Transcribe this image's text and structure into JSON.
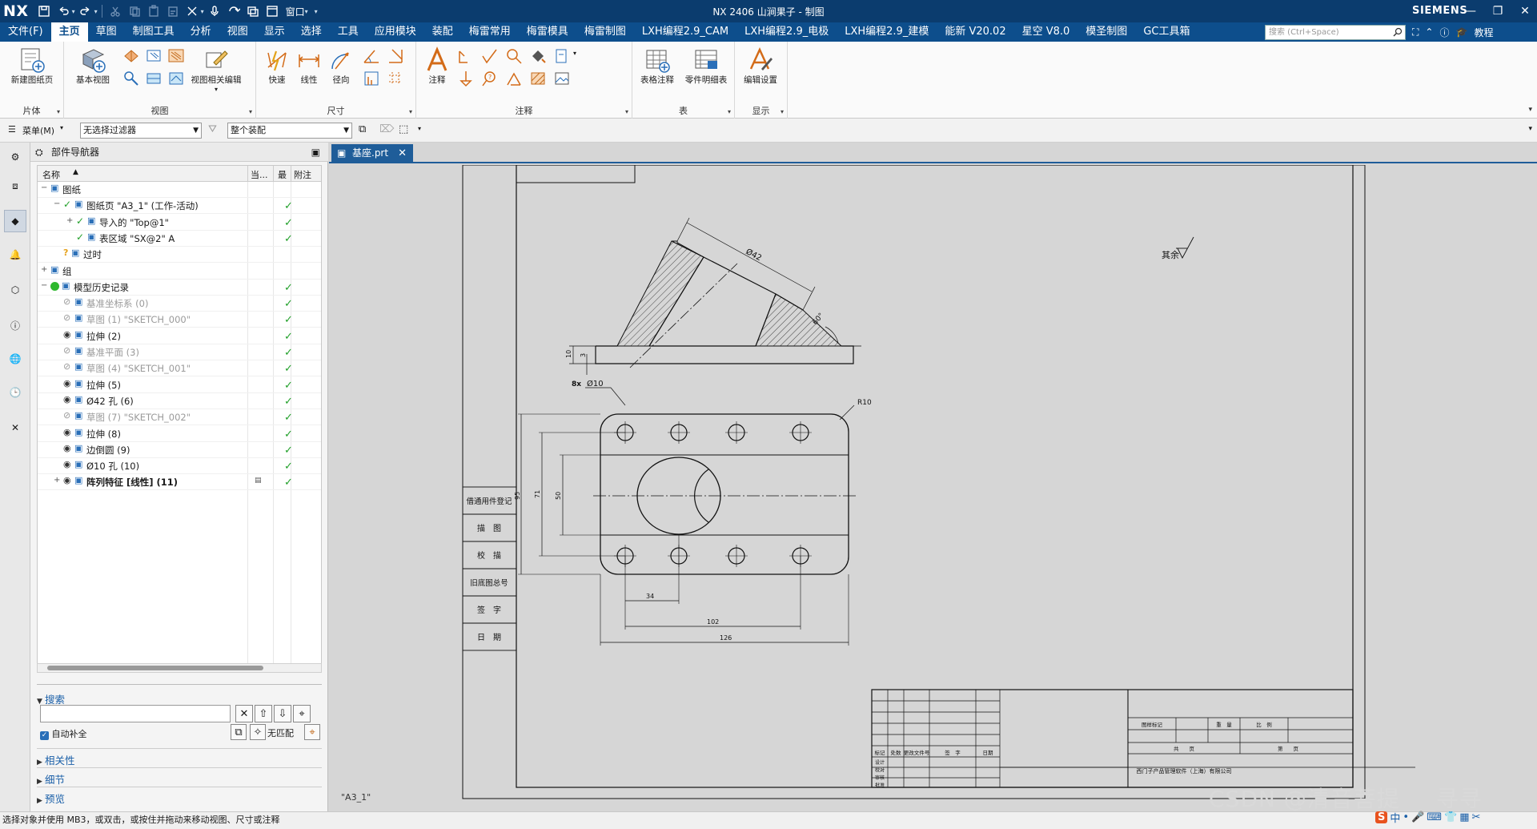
{
  "titlebar": {
    "logo": "NX",
    "window_menu": "窗口",
    "title": "NX 2406 山涧果子 - 制图",
    "brand": "SIEMENS",
    "quick_access": [
      "save-icon",
      "undo-icon",
      "redo-icon",
      "cut-icon",
      "copy-icon",
      "paste-icon",
      "delete-icon",
      "mic-icon",
      "repeat-icon",
      "window-icon"
    ]
  },
  "menubar": {
    "tabs": [
      "文件(F)",
      "主页",
      "草图",
      "制图工具",
      "分析",
      "视图",
      "显示",
      "选择",
      "工具",
      "应用模块",
      "装配",
      "梅雷常用",
      "梅雷模具",
      "梅雷制图",
      "LXH编程2.9_CAM",
      "LXH编程2.9_电极",
      "LXH编程2.9_建模",
      "能新 V20.02",
      "星空 V8.0",
      "模圣制图",
      "GC工具箱"
    ],
    "active_index": 1,
    "search_placeholder": "搜索 (Ctrl+Space)",
    "tutorial": "教程"
  },
  "ribbon": {
    "groups": [
      {
        "label": "片体",
        "buttons": [
          {
            "label": "新建图纸页",
            "icon": "new-sheet-icon"
          }
        ]
      },
      {
        "label": "视图",
        "buttons": [
          {
            "label": "基本视图",
            "icon": "base-view-icon"
          },
          {
            "label": "视图相关编辑",
            "icon": "view-edit-icon"
          }
        ]
      },
      {
        "label": "尺寸",
        "buttons": [
          {
            "label": "快速",
            "icon": "rapid-dim-icon"
          },
          {
            "label": "线性",
            "icon": "linear-dim-icon"
          },
          {
            "label": "径向",
            "icon": "radial-dim-icon"
          }
        ]
      },
      {
        "label": "注释",
        "buttons": [
          {
            "label": "注释",
            "icon": "note-icon"
          }
        ]
      },
      {
        "label": "表",
        "buttons": [
          {
            "label": "表格注释",
            "icon": "table-note-icon"
          },
          {
            "label": "零件明细表",
            "icon": "parts-list-icon"
          }
        ]
      },
      {
        "label": "显示",
        "buttons": [
          {
            "label": "编辑设置",
            "icon": "edit-settings-icon"
          }
        ]
      }
    ]
  },
  "toolbar2": {
    "menu_label": "菜单(M)",
    "filter_value": "无选择过滤器",
    "scope_value": "整个装配"
  },
  "navigator": {
    "title": "部件导航器",
    "columns": [
      "名称",
      "当...",
      "最",
      "附注"
    ],
    "rows": [
      {
        "label": "图纸",
        "indent": 0,
        "expand": "-",
        "check": false,
        "style": "normal"
      },
      {
        "label": "图纸页 \"A3_1\" (工作-活动)",
        "indent": 1,
        "expand": "-",
        "check": true,
        "style": "normal"
      },
      {
        "label": "导入的 \"Top@1\"",
        "indent": 2,
        "expand": "+",
        "check": true,
        "style": "normal"
      },
      {
        "label": "表区域 \"SX@2\" A",
        "indent": 2,
        "expand": "",
        "check": true,
        "style": "normal"
      },
      {
        "label": "过时",
        "indent": 1,
        "expand": "",
        "check": false,
        "style": "normal"
      },
      {
        "label": "组",
        "indent": 0,
        "expand": "+",
        "check": false,
        "style": "normal"
      },
      {
        "label": "模型历史记录",
        "indent": 0,
        "expand": "-",
        "check": true,
        "style": "normal"
      },
      {
        "label": "基准坐标系 (0)",
        "indent": 1,
        "expand": "",
        "check": true,
        "style": "dim"
      },
      {
        "label": "草图 (1) \"SKETCH_000\"",
        "indent": 1,
        "expand": "",
        "check": true,
        "style": "dim"
      },
      {
        "label": "拉伸 (2)",
        "indent": 1,
        "expand": "",
        "check": true,
        "style": "normal"
      },
      {
        "label": "基准平面 (3)",
        "indent": 1,
        "expand": "",
        "check": true,
        "style": "dim"
      },
      {
        "label": "草图 (4) \"SKETCH_001\"",
        "indent": 1,
        "expand": "",
        "check": true,
        "style": "dim"
      },
      {
        "label": "拉伸 (5)",
        "indent": 1,
        "expand": "",
        "check": true,
        "style": "normal"
      },
      {
        "label": "Ø42 孔 (6)",
        "indent": 1,
        "expand": "",
        "check": true,
        "style": "normal"
      },
      {
        "label": "草图 (7) \"SKETCH_002\"",
        "indent": 1,
        "expand": "",
        "check": true,
        "style": "dim"
      },
      {
        "label": "拉伸 (8)",
        "indent": 1,
        "expand": "",
        "check": true,
        "style": "normal"
      },
      {
        "label": "边倒圆 (9)",
        "indent": 1,
        "expand": "",
        "check": true,
        "style": "normal"
      },
      {
        "label": "Ø10 孔 (10)",
        "indent": 1,
        "expand": "",
        "check": true,
        "style": "normal"
      },
      {
        "label": "阵列特征 [线性] (11)",
        "indent": 1,
        "expand": "+",
        "check": true,
        "style": "bold"
      }
    ],
    "search_section": "搜索",
    "auto_complete": "自动补全",
    "no_match": "无匹配",
    "sections": [
      "相关性",
      "细节",
      "预览"
    ]
  },
  "document": {
    "tab_label": "基座.prt",
    "sheet_name": "\"A3_1\""
  },
  "drawing": {
    "dims_top": [
      "Ø42",
      "60°",
      "10",
      "3"
    ],
    "surface_note": "其余",
    "hole_callout_count": "8x",
    "hole_callout_dia": "Ø10",
    "radius": "R10",
    "dims_plan": [
      "95",
      "71",
      "50",
      "34",
      "102",
      "126"
    ],
    "side_cells": [
      "借通用件登记",
      "描　图",
      "校　描",
      "旧底图总号",
      "签　字",
      "日　期"
    ],
    "tb_header": [
      "标记",
      "处数",
      "更改文件号",
      "签　字",
      "日期"
    ],
    "tb_left_rows": [
      "设计",
      "校对",
      "审核",
      "批准"
    ],
    "tb_right_top": [
      "图样标记",
      "重　量",
      "比　例"
    ],
    "tb_right_mid": [
      "共　　页",
      "第　　页"
    ],
    "company": "西门子产品管理软件（上海）有限公司"
  },
  "status": {
    "text": "选择对象并使用 MB3，或双击，或按住并拖动来移动视图、尺寸或注释"
  },
  "watermark": "CSDN @清音菩提___寻寻",
  "tray": [
    "S",
    "中",
    "•",
    "mic-icon",
    "keyboard-icon",
    "shirt-icon",
    "grid-icon",
    "shirt2-icon"
  ]
}
